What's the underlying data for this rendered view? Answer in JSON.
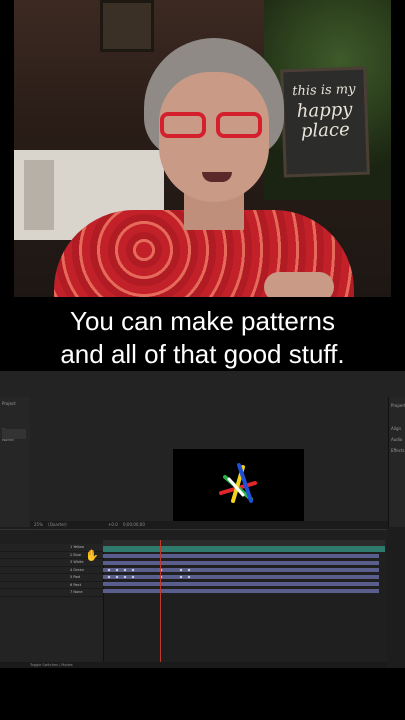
{
  "caption": {
    "line1": "You can make patterns",
    "line2": "and all of that good stuff."
  },
  "video": {
    "sign_line1": "this is my",
    "sign_line2": "happy",
    "sign_line3": "place"
  },
  "ae": {
    "right_panel": [
      "Properties",
      "Align",
      "Audio",
      "Effects & Presets"
    ],
    "left_panel": [
      "Project",
      "Na...",
      "Name"
    ],
    "viewbar": [
      "25%",
      "(Quarter)",
      "+0.0",
      "0;00;00;00"
    ],
    "layers": [
      "1 Yellow",
      "2 Blue",
      "3 White",
      "4 Green",
      "5 Red",
      "6 Rect",
      "7 None"
    ],
    "footer": "Toggle Switches / Modes",
    "colors": {
      "star_yellow": "#f2d21b",
      "star_blue": "#1f4fd6",
      "star_white": "#ffffff",
      "star_green": "#2bb34a",
      "star_red": "#e0262b",
      "workarea": "#2f7a6d",
      "layer_bar": "#5a5e8c",
      "playhead": "#c0392b"
    }
  }
}
